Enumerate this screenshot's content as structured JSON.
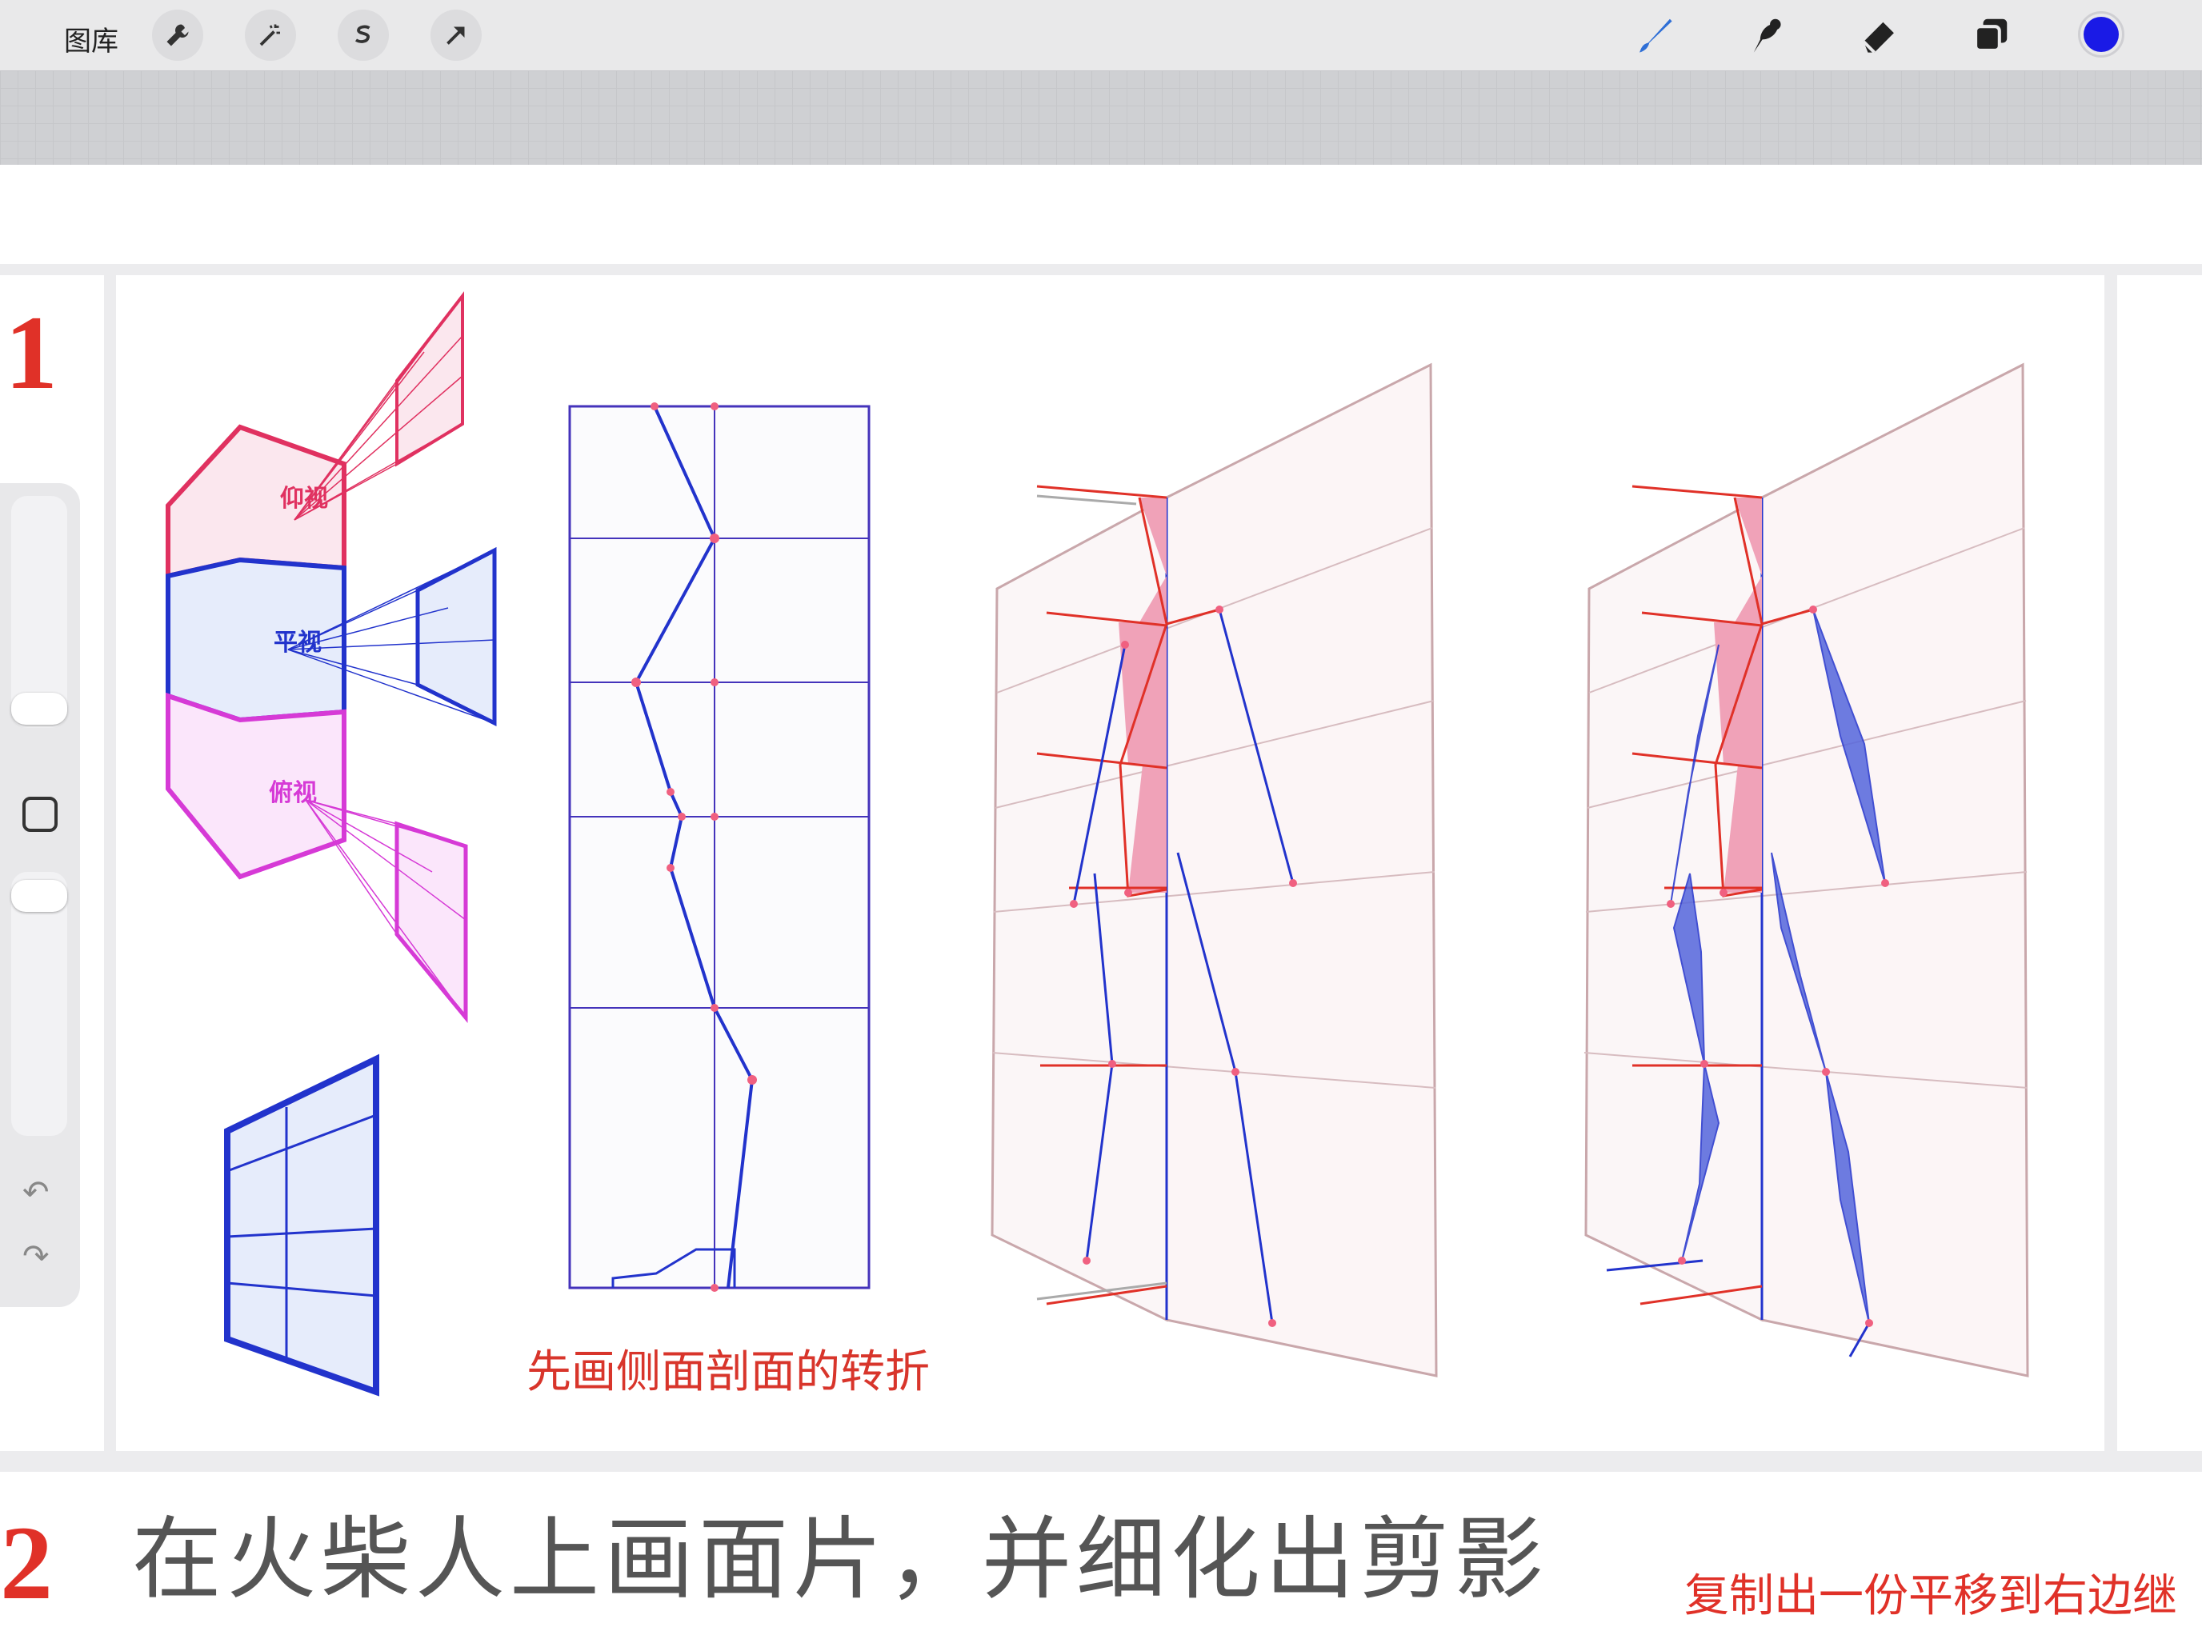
{
  "toolbar": {
    "gallery_label": "图库",
    "left_tools": [
      "wrench-icon",
      "magic-wand-icon",
      "selection-icon",
      "transform-arrow-icon"
    ],
    "right_tools": [
      "brush-icon",
      "smudge-icon",
      "eraser-icon",
      "layers-icon"
    ],
    "current_color": "#1a1ae6"
  },
  "canvas": {
    "step1_number": "1",
    "step2_number": "2",
    "headline": "在火柴人上画面片，并细化出剪影",
    "right_note": "复制出一份平移到右边继",
    "caption": "先画侧面剖面的转折",
    "view_labels": {
      "up_view": "仰视",
      "level_view": "平视",
      "down_view": "俯视"
    }
  },
  "colors": {
    "red": "#e03128",
    "blue": "#2233cc",
    "magenta": "#d63ad6",
    "pink_fill": "#f0a2b8"
  }
}
